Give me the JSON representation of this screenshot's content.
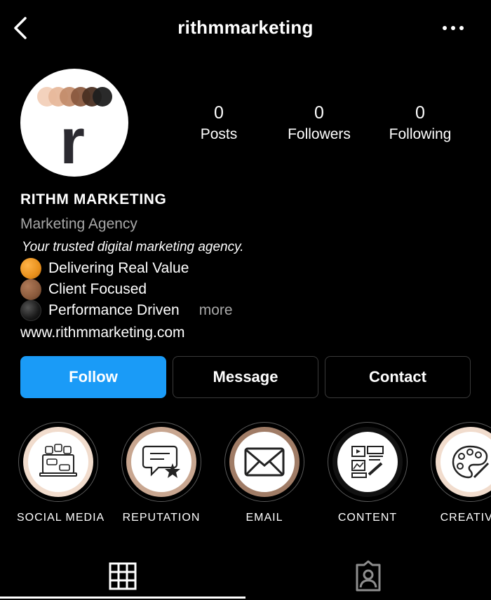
{
  "header": {
    "username": "rithmmarketing",
    "back_icon": "chevron-left-icon",
    "menu_icon": "more-horizontal-icon"
  },
  "profile": {
    "avatar_letter": "r",
    "stats": [
      {
        "count": "0",
        "label": "Posts"
      },
      {
        "count": "0",
        "label": "Followers"
      },
      {
        "count": "0",
        "label": "Following"
      }
    ],
    "name": "RITHM MARKETING",
    "category": "Marketing Agency",
    "tagline": "Your trusted digital marketing agency.",
    "bio_lines": [
      {
        "text": "Delivering Real Value",
        "dot_color": "#e8901c"
      },
      {
        "text": "Client Focused",
        "dot_color": "#8a5a3c"
      },
      {
        "text": "Performance Driven",
        "dot_color": "#1a1a1a"
      }
    ],
    "more_label": "more",
    "website": "www.rithmmarketing.com"
  },
  "actions": {
    "follow": "Follow",
    "message": "Message",
    "contact": "Contact"
  },
  "highlights": [
    {
      "label": "SOCIAL MEDIA",
      "icon": "social-media-icon"
    },
    {
      "label": "REPUTATION",
      "icon": "review-star-icon"
    },
    {
      "label": "EMAIL",
      "icon": "envelope-icon"
    },
    {
      "label": "CONTENT",
      "icon": "content-icon"
    },
    {
      "label": "CREATIVE",
      "icon": "palette-icon"
    }
  ],
  "tabs": [
    {
      "name": "grid-icon",
      "active": true
    },
    {
      "name": "tagged-icon",
      "active": false
    }
  ],
  "colors": {
    "accent": "#1a9bf7",
    "background": "#000000",
    "muted_text": "#a8a8a8"
  }
}
